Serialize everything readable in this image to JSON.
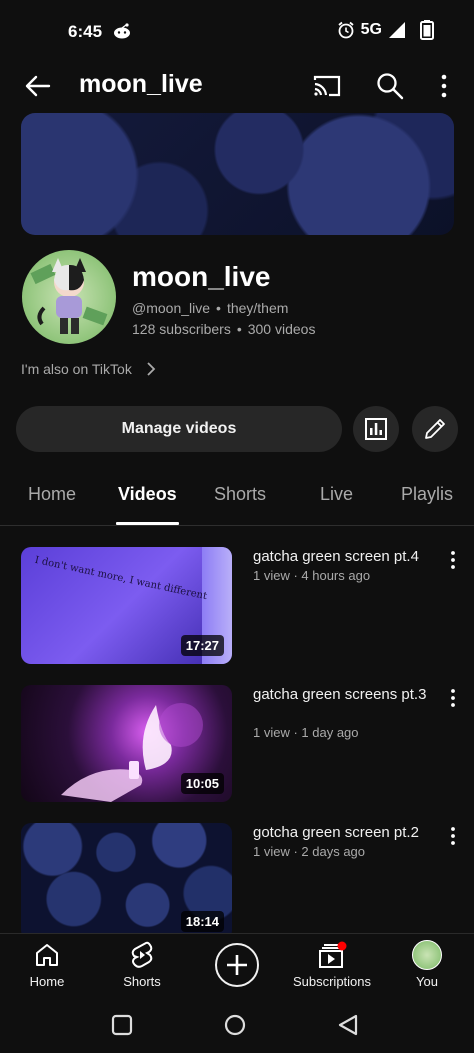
{
  "status_bar": {
    "time": "6:45",
    "network": "5G",
    "icons": [
      "reddit-icon",
      "alarm-icon",
      "signal-icon",
      "battery-icon"
    ]
  },
  "top_bar": {
    "title": "moon_live",
    "icons": [
      "back-arrow-icon",
      "cast-icon",
      "search-icon",
      "more-vert-icon"
    ]
  },
  "channel": {
    "name": "moon_live",
    "handle": "@moon_live",
    "pronouns": "they/them",
    "subscribers": "128 subscribers",
    "videos_count": "300 videos",
    "separator": "•",
    "link_text": "I'm also on TikTok"
  },
  "actions": {
    "manage_label": "Manage videos",
    "analytics_icon": "analytics-icon",
    "edit_icon": "pencil-icon"
  },
  "tabs": [
    {
      "label": "Home",
      "active": false
    },
    {
      "label": "Videos",
      "active": true
    },
    {
      "label": "Shorts",
      "active": false
    },
    {
      "label": "Live",
      "active": false
    },
    {
      "label": "Playlis",
      "active": false
    }
  ],
  "videos": [
    {
      "title": "gatcha green screen pt.4",
      "meta": "1 view · 4 hours ago",
      "duration": "17:27",
      "thumb_text": "I don't want more, I want different"
    },
    {
      "title": "gatcha green screens pt.3",
      "meta": "1 view · 1 day ago",
      "duration": "10:05"
    },
    {
      "title": "gotcha green screen pt.2",
      "meta": "1 view · 2 days ago",
      "duration": "18:14"
    }
  ],
  "bottom_nav": {
    "home": "Home",
    "shorts": "Shorts",
    "subscriptions": "Subscriptions",
    "you": "You",
    "notification_color": "#ff0000"
  },
  "colors": {
    "background": "#0f0f0f",
    "surface": "#272727",
    "secondary_text": "#aaaaaa"
  }
}
